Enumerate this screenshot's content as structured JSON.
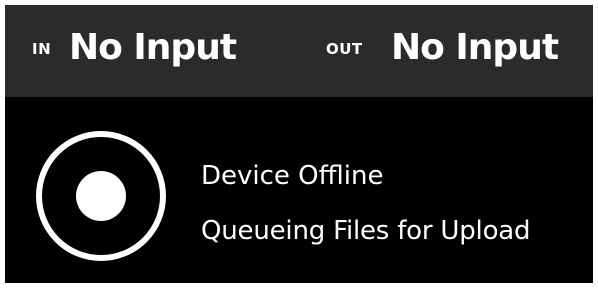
{
  "io": {
    "in_label": "IN",
    "in_value": "No Input",
    "out_label": "OUT",
    "out_value": "No Input"
  },
  "status": {
    "icon": "record-ring-icon",
    "line1": "Device Offline",
    "line2": "Queueing Files for Upload"
  },
  "colors": {
    "background": "#000000",
    "header_background": "#2b2b2b",
    "text": "#ffffff"
  }
}
